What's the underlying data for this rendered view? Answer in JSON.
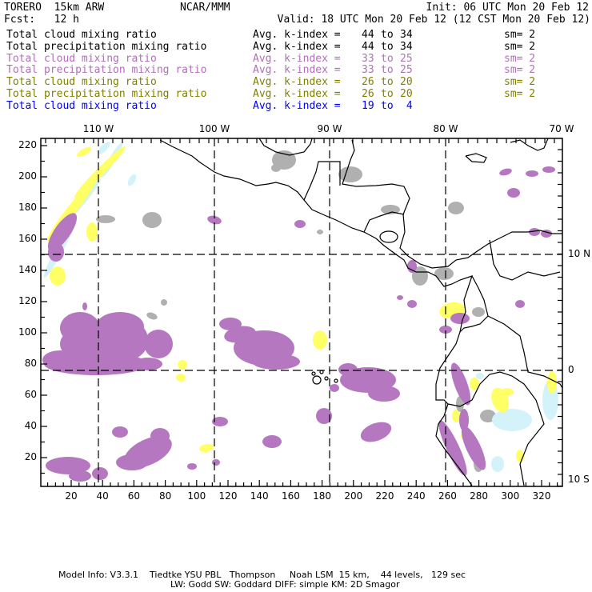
{
  "header": {
    "model": "TORERO  15km ARW",
    "org": "NCAR/MMM",
    "init": "Init: 06 UTC Mon 20 Feb 12",
    "fcst": "Fcst:   12 h",
    "valid": "Valid: 18 UTC Mon 20 Feb 12 (12 CST Mon 20 Feb 12)"
  },
  "colors": {
    "black": "#000000",
    "purple": "#b070b8",
    "olive": "#808000",
    "blue": "#0000ff",
    "cloud_purple": "#b577c0",
    "gray": "#b0b0b0",
    "yellow": "#ffff66",
    "lightblue": "#d4f2fa"
  },
  "legend": [
    {
      "field": "Total cloud mixing ratio",
      "avg": "Avg. k-index =",
      "from": "44",
      "to_word": "to",
      "to": "34",
      "sm": "sm= 2",
      "color": "#000000"
    },
    {
      "field": "Total precipitation mixing ratio",
      "avg": "Avg. k-index =",
      "from": "44",
      "to_word": "to",
      "to": "34",
      "sm": "sm= 2",
      "color": "#000000"
    },
    {
      "field": "Total cloud mixing ratio",
      "avg": "Avg. k-index =",
      "from": "33",
      "to_word": "to",
      "to": "25",
      "sm": "sm= 2",
      "color": "#b070b8"
    },
    {
      "field": "Total precipitation mixing ratio",
      "avg": "Avg. k-index =",
      "from": "33",
      "to_word": "to",
      "to": "25",
      "sm": "sm= 2",
      "color": "#b070b8"
    },
    {
      "field": "Total cloud mixing ratio",
      "avg": "Avg. k-index =",
      "from": "26",
      "to_word": "to",
      "to": "20",
      "sm": "sm= 2",
      "color": "#808000"
    },
    {
      "field": "Total precipitation mixing ratio",
      "avg": "Avg. k-index =",
      "from": "26",
      "to_word": "to",
      "to": "20",
      "sm": "sm= 2",
      "color": "#808000"
    },
    {
      "field": "Total cloud mixing ratio",
      "avg": "Avg. k-index =",
      "from": "19",
      "to_word": "to",
      "to": " 4",
      "sm": "",
      "color": "#0000ff"
    }
  ],
  "axes": {
    "x_ticks": [
      "20",
      "40",
      "60",
      "80",
      "100",
      "120",
      "140",
      "160",
      "180",
      "200",
      "220",
      "240",
      "260",
      "280",
      "300",
      "320"
    ],
    "y_ticks": [
      "20",
      "40",
      "60",
      "80",
      "100",
      "120",
      "140",
      "160",
      "180",
      "200",
      "220"
    ],
    "lon_labels": [
      "110 W",
      "100 W",
      "90 W",
      "80 W",
      "70 W"
    ],
    "lat_labels": [
      "10 N",
      "0",
      "10 S"
    ]
  },
  "footer": {
    "line1": "Model Info: V3.3.1    Tiedtke YSU PBL   Thompson     Noah LSM  15 km,    44 levels,   129 sec",
    "line2": "LW: Godd SW: Goddard DIFF: simple KM: 2D Smagor"
  }
}
